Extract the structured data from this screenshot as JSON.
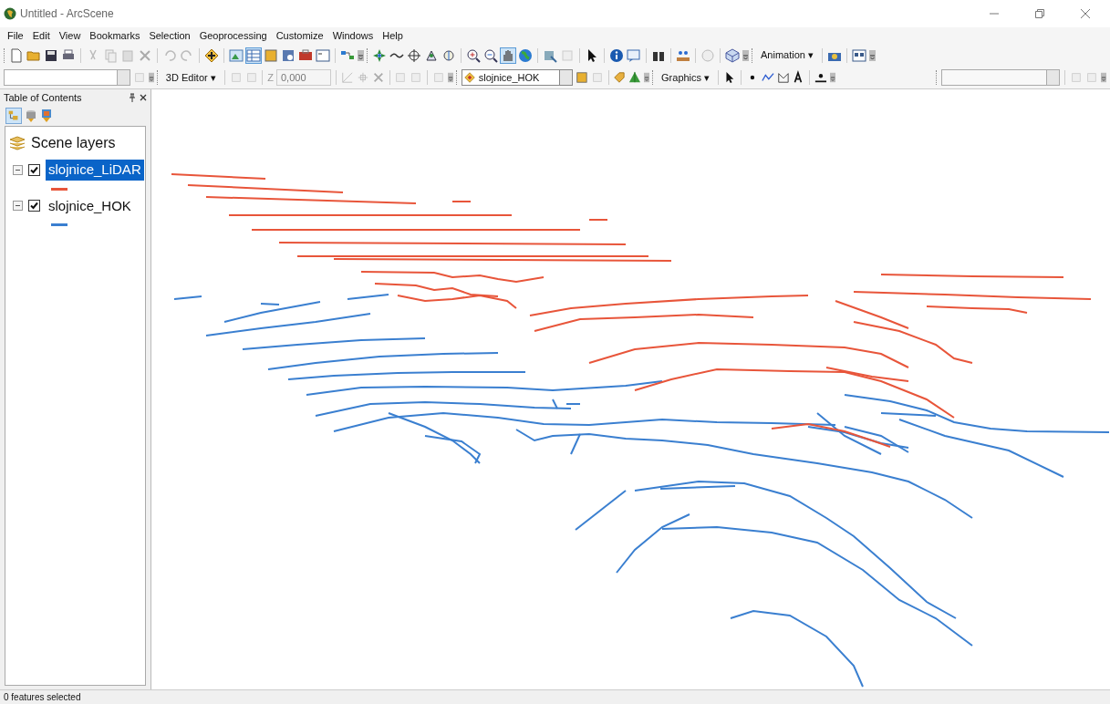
{
  "window": {
    "title": "Untitled - ArcScene"
  },
  "menu": [
    "File",
    "Edit",
    "View",
    "Bookmarks",
    "Selection",
    "Geoprocessing",
    "Customize",
    "Windows",
    "Help"
  ],
  "toolbar_1": {
    "animation_menu": "Animation ▾"
  },
  "toolbar_2": {
    "editor_menu": "3D Editor ▾",
    "z_label": "Z",
    "z_value": "0,000",
    "layer_select": "slojnice_HOK",
    "graphics_menu": "Graphics ▾"
  },
  "table_of_contents": {
    "title": "Table of Contents",
    "root": "Scene layers",
    "layers": [
      {
        "name": "slojnice_LiDAR",
        "checked": true,
        "selected": true,
        "expanded": true,
        "color": "#e8553a"
      },
      {
        "name": "slojnice_HOK",
        "checked": true,
        "selected": false,
        "expanded": true,
        "color": "#3a7fd0"
      }
    ]
  },
  "status_bar": "0 features selected"
}
